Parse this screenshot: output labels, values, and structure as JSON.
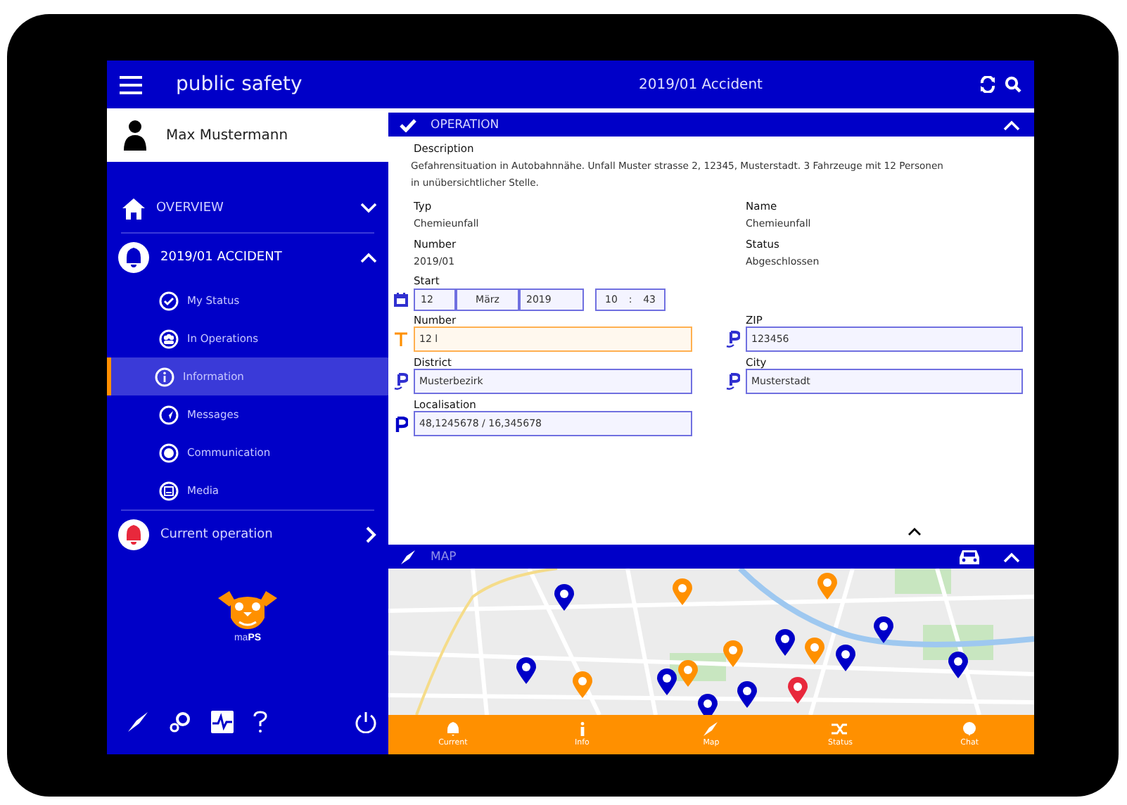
{
  "app": {
    "title": "public safety"
  },
  "user": {
    "name": "Max Mustermann"
  },
  "nav": [
    {
      "label": "OVERVIEW",
      "kind": "home",
      "expanded": false
    },
    {
      "label": "2019/01 ACCIDENT",
      "kind": "incident",
      "expanded": true,
      "children": [
        {
          "label": "My Status",
          "kind": "check",
          "selected": false
        },
        {
          "label": "In Operations",
          "kind": "group",
          "selected": false
        },
        {
          "label": "Information",
          "kind": "info",
          "selected": true
        },
        {
          "label": "Messages",
          "kind": "send",
          "selected": false
        },
        {
          "label": "Communication",
          "kind": "dot",
          "selected": false
        },
        {
          "label": "Media",
          "kind": "media",
          "selected": false
        }
      ]
    },
    {
      "label": "Current operation",
      "kind": "alarm",
      "expanded": false
    }
  ],
  "logo": {
    "text": "ma**PS**"
  },
  "header": {
    "title": "2019/01 Accident"
  },
  "operation": {
    "title": "OPERATION",
    "expanded": true,
    "description": {
      "label": "Description",
      "text": "Gefahrensituation in Autobahnnähe. Unfall Muster strasse 2, 12345, Musterstadt. 3 Fahrzeuge mit 12 Personen in unübersichtlicher Stelle."
    },
    "info": [
      {
        "label": "Typ",
        "value": "Chemieunfall"
      },
      {
        "label": "Name",
        "value": "Chemieunfall"
      },
      {
        "label": "Number",
        "value": "2019/01"
      },
      {
        "label": "Status",
        "value": "Abgeschlossen"
      }
    ],
    "start": {
      "label": "Start",
      "day": "12",
      "month": "März",
      "year": "2019",
      "hour": "10",
      "separator": ":",
      "minute": "43"
    },
    "inputs": [
      {
        "label": "Number",
        "value": "12 l",
        "kind": "text",
        "focused": true
      },
      {
        "label": "ZIP",
        "value": "123456",
        "kind": "location",
        "focused": false
      },
      {
        "label": "District",
        "value": "Musterbezirk",
        "kind": "location",
        "focused": false
      },
      {
        "label": "City",
        "value": "Musterstadt",
        "kind": "location",
        "focused": false
      },
      {
        "label": "Localisation",
        "value": "48,1245678 / 16,345678",
        "kind": "place",
        "focused": false
      }
    ]
  },
  "map": {
    "title": "MAP",
    "expanded": true
  },
  "bottom_nav": [
    {
      "label": "Current",
      "kind": "bell"
    },
    {
      "label": "Info",
      "kind": "info"
    },
    {
      "label": "Map",
      "kind": "compass"
    },
    {
      "label": "Status",
      "kind": "shuffle"
    },
    {
      "label": "Chat",
      "kind": "chat"
    }
  ]
}
